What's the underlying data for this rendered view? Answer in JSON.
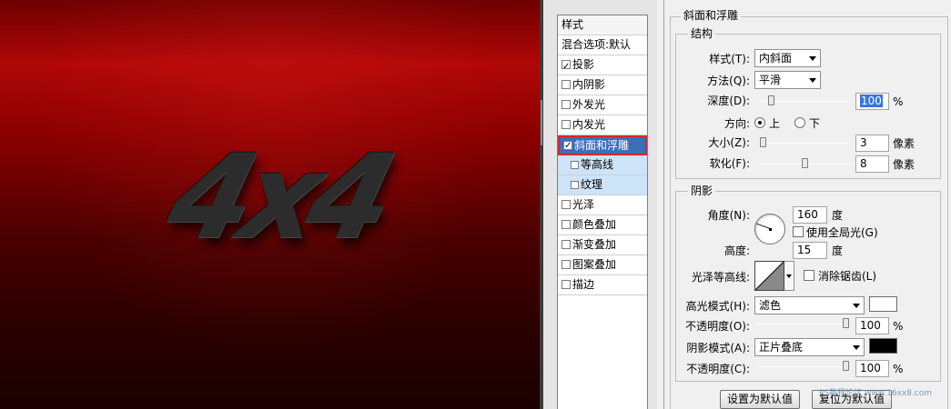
{
  "canvas": {
    "artwork_text": "4x4",
    "colors": {
      "background_top": "#b00707",
      "background_bottom": "#1a0000",
      "text": "#2c2c2c"
    }
  },
  "styles": {
    "header": "样式",
    "blend_options": "混合选项:默认",
    "items": [
      {
        "label": "投影",
        "checked": true
      },
      {
        "label": "内阴影",
        "checked": false
      },
      {
        "label": "外发光",
        "checked": false
      },
      {
        "label": "内发光",
        "checked": false
      },
      {
        "label": "斜面和浮雕",
        "checked": true,
        "selected": true
      },
      {
        "label": "等高线",
        "checked": false,
        "sub": true
      },
      {
        "label": "纹理",
        "checked": false,
        "sub": true
      },
      {
        "label": "光泽",
        "checked": false
      },
      {
        "label": "颜色叠加",
        "checked": false
      },
      {
        "label": "渐变叠加",
        "checked": false
      },
      {
        "label": "图案叠加",
        "checked": false
      },
      {
        "label": "描边",
        "checked": false
      }
    ]
  },
  "bevel": {
    "title": "斜面和浮雕",
    "structure": {
      "title": "结构",
      "style_label": "样式(T):",
      "style_value": "内斜面",
      "technique_label": "方法(Q):",
      "technique_value": "平滑",
      "depth_label": "深度(D):",
      "depth_value": "100",
      "depth_slider": 0.1,
      "percent": "%",
      "direction_label": "方向:",
      "direction_up": "上",
      "direction_down": "下",
      "direction_selected": "up",
      "size_label": "大小(Z):",
      "size_value": "3",
      "size_slider": 0.0,
      "size_unit": "像素",
      "soften_label": "软化(F):",
      "soften_value": "8",
      "soften_slider": 0.5,
      "soften_unit": "像素"
    },
    "shading": {
      "title": "阴影",
      "angle_label": "角度(N):",
      "angle_value": "160",
      "angle_unit": "度",
      "global_light_label": "使用全局光(G)",
      "global_light_checked": false,
      "altitude_label": "高度:",
      "altitude_value": "15",
      "altitude_unit": "度",
      "gloss_contour_label": "光泽等高线:",
      "anti_alias_label": "消除锯齿(L)",
      "anti_alias_checked": false,
      "highlight_mode_label": "高光模式(H):",
      "highlight_mode_value": "滤色",
      "highlight_color": "#ffffff",
      "highlight_opacity_label": "不透明度(O):",
      "highlight_opacity_value": "100",
      "highlight_opacity_slider": 1.0,
      "shadow_mode_label": "阴影模式(A):",
      "shadow_mode_value": "正片叠底",
      "shadow_color": "#000000",
      "shadow_opacity_label": "不透明度(C):",
      "shadow_opacity_value": "100",
      "shadow_opacity_slider": 1.0,
      "percent": "%"
    },
    "buttons": {
      "make_default": "设置为默认值",
      "reset_default": "复位为默认值"
    }
  },
  "watermark": "PS教程论坛 www.16xx8.com"
}
